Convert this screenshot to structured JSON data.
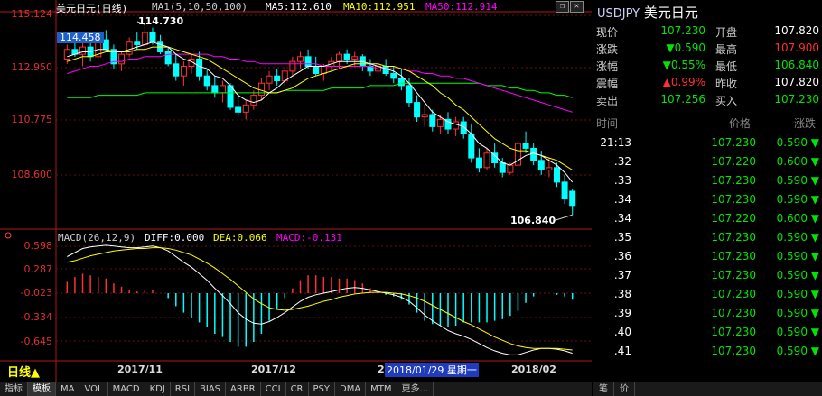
{
  "header": {
    "symbol_line": "美元日元(日线)",
    "ma_label": "MA1(5,10,50,100)",
    "ma5": "MA5:112.610",
    "ma10": "MA10:112.951",
    "ma50": "MA50:112.914"
  },
  "price_axis": [
    "115.124",
    "112.950",
    "110.775",
    "108.600"
  ],
  "macd_axis": [
    "0.598",
    "0.287",
    "-0.023",
    "-0.334",
    "-0.645"
  ],
  "annotations": {
    "high": "114.730",
    "low": "106.840",
    "cursor_price": "114.458"
  },
  "macd_header": {
    "label": "MACD(26,12,9)",
    "diff": "DIFF:0.000",
    "dea": "DEA:0.066",
    "macd": "MACD:-0.131"
  },
  "x_axis": [
    "2017/11",
    "2017/12",
    "2",
    "2018/02"
  ],
  "cursor_date": "2018/01/29 星期一",
  "period_label": "日线▲",
  "tabs": [
    "指标",
    "模板",
    "MA",
    "VOL",
    "MACD",
    "KDJ",
    "RSI",
    "BIAS",
    "ARBR",
    "CCI",
    "CR",
    "PSY",
    "DMA",
    "MTM",
    "更多..."
  ],
  "quote": {
    "code": "USDJPY",
    "name": "美元日元",
    "rows": [
      {
        "l1": "现价",
        "v1": "107.230",
        "c1": "#00e600",
        "l2": "开盘",
        "v2": "107.820",
        "c2": "#ffffff"
      },
      {
        "l1": "涨跌",
        "v1": "▼0.590",
        "c1": "#00e600",
        "l2": "最高",
        "v2": "107.900",
        "c2": "#ff3030"
      },
      {
        "l1": "涨幅",
        "v1": "▼0.55%",
        "c1": "#00e600",
        "l2": "最低",
        "v2": "106.840",
        "c2": "#00e600"
      },
      {
        "l1": "震幅",
        "v1": "▲0.99%",
        "c1": "#ff3030",
        "l2": "昨收",
        "v2": "107.820",
        "c2": "#ffffff"
      },
      {
        "l1": "卖出",
        "v1": "107.256",
        "c1": "#00e600",
        "l2": "买入",
        "v2": "107.230",
        "c2": "#00e600"
      }
    ]
  },
  "ticks_header": {
    "time": "时间",
    "price": "价格",
    "change": "涨跌"
  },
  "ticks": [
    {
      "t": "21:13",
      "p": "107.230",
      "c": "0.590 ▼"
    },
    {
      "t": ".32",
      "p": "107.220",
      "c": "0.600 ▼"
    },
    {
      "t": ".33",
      "p": "107.230",
      "c": "0.590 ▼"
    },
    {
      "t": ".34",
      "p": "107.230",
      "c": "0.590 ▼"
    },
    {
      "t": ".34",
      "p": "107.220",
      "c": "0.600 ▼"
    },
    {
      "t": ".35",
      "p": "107.230",
      "c": "0.590 ▼"
    },
    {
      "t": ".36",
      "p": "107.230",
      "c": "0.590 ▼"
    },
    {
      "t": ".37",
      "p": "107.230",
      "c": "0.590 ▼"
    },
    {
      "t": ".38",
      "p": "107.230",
      "c": "0.590 ▼"
    },
    {
      "t": ".39",
      "p": "107.230",
      "c": "0.590 ▼"
    },
    {
      "t": ".40",
      "p": "107.230",
      "c": "0.590 ▼"
    },
    {
      "t": ".41",
      "p": "107.230",
      "c": "0.590 ▼"
    }
  ],
  "right_tabs": [
    "笔",
    "价"
  ],
  "colors": {
    "up": "#ff3030",
    "down": "#00ffff",
    "ma5": "#ffffff",
    "ma10": "#ffff00",
    "ma50": "#ff00ff",
    "ma100": "#00ff00"
  },
  "chart_data": {
    "type": "candlestick",
    "ylim": [
      106.4,
      115.3
    ],
    "candles": [
      [
        113.3,
        113.9,
        113.1,
        113.7
      ],
      [
        113.7,
        114.2,
        113.4,
        113.5
      ],
      [
        113.5,
        114.0,
        113.0,
        113.8
      ],
      [
        113.8,
        114.1,
        113.2,
        113.4
      ],
      [
        113.4,
        114.3,
        113.3,
        114.1
      ],
      [
        114.1,
        114.5,
        113.6,
        113.7
      ],
      [
        113.7,
        113.9,
        112.9,
        113.1
      ],
      [
        113.1,
        113.6,
        112.8,
        113.5
      ],
      [
        113.5,
        114.2,
        113.4,
        114.0
      ],
      [
        114.0,
        114.4,
        113.7,
        113.9
      ],
      [
        113.9,
        114.73,
        113.6,
        114.4
      ],
      [
        114.4,
        114.6,
        113.9,
        114.0
      ],
      [
        114.0,
        114.3,
        113.5,
        113.6
      ],
      [
        113.6,
        113.8,
        113.0,
        113.1
      ],
      [
        113.1,
        113.5,
        112.4,
        112.6
      ],
      [
        112.6,
        113.2,
        112.2,
        113.0
      ],
      [
        113.0,
        113.5,
        112.7,
        113.3
      ],
      [
        113.3,
        113.6,
        112.4,
        112.6
      ],
      [
        112.6,
        112.9,
        112.0,
        112.2
      ],
      [
        112.2,
        112.6,
        111.7,
        111.9
      ],
      [
        111.9,
        112.4,
        111.5,
        112.2
      ],
      [
        112.2,
        112.3,
        111.2,
        111.3
      ],
      [
        111.3,
        111.7,
        110.9,
        111.1
      ],
      [
        111.1,
        111.6,
        110.8,
        111.4
      ],
      [
        111.4,
        112.0,
        111.2,
        111.8
      ],
      [
        111.8,
        112.5,
        111.6,
        112.3
      ],
      [
        112.3,
        112.8,
        112.0,
        112.6
      ],
      [
        112.6,
        112.9,
        112.2,
        112.4
      ],
      [
        112.4,
        113.0,
        112.2,
        112.8
      ],
      [
        112.8,
        113.4,
        112.6,
        113.2
      ],
      [
        113.2,
        113.6,
        112.9,
        113.4
      ],
      [
        113.4,
        113.7,
        112.9,
        113.0
      ],
      [
        113.0,
        113.4,
        112.6,
        112.7
      ],
      [
        112.7,
        113.1,
        112.4,
        113.0
      ],
      [
        113.0,
        113.4,
        112.8,
        113.2
      ],
      [
        113.2,
        113.6,
        112.9,
        113.5
      ],
      [
        113.5,
        113.7,
        113.1,
        113.3
      ],
      [
        113.3,
        113.6,
        113.0,
        113.4
      ],
      [
        113.4,
        113.5,
        112.8,
        113.0
      ],
      [
        113.0,
        113.3,
        112.6,
        112.8
      ],
      [
        112.8,
        113.2,
        112.5,
        113.0
      ],
      [
        113.0,
        113.3,
        112.6,
        112.7
      ],
      [
        112.7,
        113.0,
        112.3,
        112.5
      ],
      [
        112.5,
        112.9,
        112.0,
        112.2
      ],
      [
        112.2,
        112.5,
        111.3,
        111.5
      ],
      [
        111.5,
        111.8,
        110.7,
        110.9
      ],
      [
        110.9,
        111.4,
        110.5,
        111.0
      ],
      [
        111.0,
        111.2,
        110.3,
        110.5
      ],
      [
        110.5,
        111.0,
        110.2,
        110.8
      ],
      [
        110.8,
        111.1,
        110.2,
        110.4
      ],
      [
        110.4,
        110.9,
        110.1,
        110.7
      ],
      [
        110.7,
        110.9,
        110.0,
        110.2
      ],
      [
        110.2,
        110.6,
        109.0,
        109.2
      ],
      [
        109.2,
        109.6,
        108.6,
        108.8
      ],
      [
        108.8,
        109.6,
        108.7,
        109.4
      ],
      [
        109.4,
        109.8,
        108.8,
        109.0
      ],
      [
        109.0,
        109.2,
        108.4,
        108.6
      ],
      [
        108.6,
        109.0,
        108.5,
        108.9
      ],
      [
        108.9,
        110.0,
        108.8,
        109.8
      ],
      [
        109.8,
        110.3,
        109.4,
        109.6
      ],
      [
        109.6,
        109.8,
        108.9,
        109.1
      ],
      [
        109.1,
        109.5,
        108.5,
        108.7
      ],
      [
        108.7,
        109.2,
        108.4,
        108.8
      ],
      [
        108.8,
        109.0,
        108.0,
        108.2
      ],
      [
        108.2,
        108.5,
        107.3,
        107.5
      ],
      [
        107.82,
        107.9,
        106.84,
        107.23
      ]
    ],
    "ma5": [
      113.4,
      113.5,
      113.6,
      113.6,
      113.7,
      113.7,
      113.6,
      113.6,
      113.7,
      113.8,
      113.9,
      114.0,
      113.9,
      113.8,
      113.5,
      113.3,
      113.2,
      113.0,
      112.9,
      112.6,
      112.5,
      112.2,
      111.8,
      111.6,
      111.5,
      111.6,
      111.9,
      112.1,
      112.4,
      112.6,
      112.8,
      113.0,
      113.0,
      113.0,
      113.1,
      113.2,
      113.2,
      113.2,
      113.2,
      113.1,
      113.0,
      112.9,
      112.8,
      112.6,
      112.3,
      111.9,
      111.5,
      111.1,
      110.9,
      110.7,
      110.6,
      110.5,
      110.2,
      109.8,
      109.6,
      109.3,
      109.0,
      108.9,
      109.1,
      109.3,
      109.4,
      109.3,
      109.1,
      108.9,
      108.6,
      108.2
    ],
    "ma10": [
      113.2,
      113.3,
      113.4,
      113.4,
      113.5,
      113.6,
      113.6,
      113.6,
      113.6,
      113.7,
      113.7,
      113.8,
      113.8,
      113.8,
      113.7,
      113.6,
      113.5,
      113.4,
      113.3,
      113.1,
      112.9,
      112.7,
      112.5,
      112.3,
      112.1,
      112.0,
      111.9,
      111.9,
      112.0,
      112.1,
      112.3,
      112.5,
      112.6,
      112.7,
      112.8,
      112.9,
      113.0,
      113.1,
      113.1,
      113.1,
      113.1,
      113.0,
      113.0,
      112.9,
      112.8,
      112.6,
      112.4,
      112.2,
      111.9,
      111.7,
      111.4,
      111.2,
      110.9,
      110.6,
      110.3,
      110.0,
      109.8,
      109.6,
      109.5,
      109.5,
      109.4,
      109.3,
      109.2,
      109.1,
      108.9,
      108.7
    ],
    "ma50": [
      112.7,
      112.8,
      112.9,
      113.0,
      113.0,
      113.1,
      113.2,
      113.2,
      113.3,
      113.3,
      113.4,
      113.4,
      113.4,
      113.5,
      113.5,
      113.5,
      113.5,
      113.5,
      113.5,
      113.4,
      113.4,
      113.3,
      113.3,
      113.2,
      113.2,
      113.1,
      113.1,
      113.1,
      113.1,
      113.1,
      113.1,
      113.1,
      113.1,
      113.0,
      113.0,
      113.0,
      113.0,
      113.0,
      113.0,
      113.0,
      112.9,
      112.9,
      112.9,
      112.9,
      112.8,
      112.8,
      112.7,
      112.7,
      112.6,
      112.6,
      112.5,
      112.5,
      112.4,
      112.3,
      112.2,
      112.1,
      112.0,
      111.9,
      111.8,
      111.7,
      111.6,
      111.5,
      111.4,
      111.3,
      111.2,
      111.1
    ],
    "ma100": [
      111.7,
      111.7,
      111.7,
      111.7,
      111.8,
      111.8,
      111.8,
      111.8,
      111.8,
      111.8,
      111.9,
      111.9,
      111.9,
      111.9,
      111.9,
      111.9,
      111.9,
      111.9,
      111.9,
      111.9,
      111.9,
      111.9,
      111.9,
      111.9,
      111.9,
      111.9,
      111.9,
      111.9,
      112.0,
      112.0,
      112.0,
      112.0,
      112.0,
      112.0,
      112.1,
      112.1,
      112.1,
      112.1,
      112.1,
      112.2,
      112.2,
      112.2,
      112.2,
      112.3,
      112.3,
      112.3,
      112.3,
      112.3,
      112.3,
      112.3,
      112.3,
      112.3,
      112.3,
      112.3,
      112.2,
      112.2,
      112.2,
      112.1,
      112.1,
      112.0,
      112.0,
      111.9,
      111.9,
      111.8,
      111.8,
      111.7
    ],
    "macd_ylim": [
      -0.8,
      0.7
    ],
    "diff": [
      0.45,
      0.5,
      0.55,
      0.57,
      0.58,
      0.59,
      0.58,
      0.57,
      0.56,
      0.56,
      0.57,
      0.58,
      0.56,
      0.52,
      0.45,
      0.38,
      0.32,
      0.24,
      0.16,
      0.06,
      -0.03,
      -0.13,
      -0.24,
      -0.32,
      -0.37,
      -0.38,
      -0.35,
      -0.3,
      -0.24,
      -0.17,
      -0.1,
      -0.05,
      -0.02,
      0.0,
      0.02,
      0.04,
      0.06,
      0.07,
      0.06,
      0.04,
      0.02,
      0.0,
      -0.02,
      -0.05,
      -0.1,
      -0.18,
      -0.27,
      -0.34,
      -0.4,
      -0.46,
      -0.5,
      -0.53,
      -0.57,
      -0.62,
      -0.67,
      -0.71,
      -0.74,
      -0.76,
      -0.76,
      -0.73,
      -0.7,
      -0.68,
      -0.68,
      -0.69,
      -0.71,
      -0.74
    ],
    "dea": [
      0.38,
      0.4,
      0.43,
      0.46,
      0.48,
      0.5,
      0.52,
      0.53,
      0.54,
      0.55,
      0.55,
      0.56,
      0.56,
      0.55,
      0.53,
      0.5,
      0.47,
      0.42,
      0.37,
      0.31,
      0.24,
      0.17,
      0.09,
      0.01,
      -0.07,
      -0.13,
      -0.18,
      -0.2,
      -0.21,
      -0.2,
      -0.18,
      -0.16,
      -0.13,
      -0.1,
      -0.08,
      -0.05,
      -0.03,
      -0.01,
      0.0,
      0.01,
      0.01,
      0.01,
      0.0,
      -0.01,
      -0.03,
      -0.06,
      -0.1,
      -0.15,
      -0.2,
      -0.25,
      -0.3,
      -0.35,
      -0.39,
      -0.44,
      -0.49,
      -0.54,
      -0.58,
      -0.62,
      -0.65,
      -0.67,
      -0.68,
      -0.68,
      -0.68,
      -0.68,
      -0.69,
      -0.7
    ]
  }
}
